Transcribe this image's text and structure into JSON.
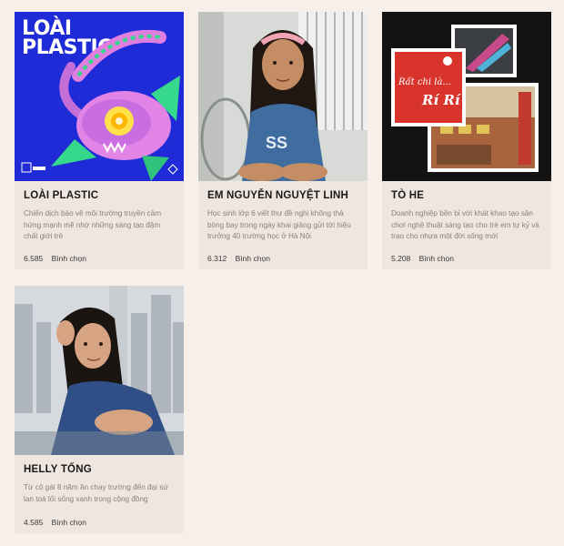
{
  "colors": {
    "page_bg": "#f7efea",
    "card_bg": "#efe6e0",
    "title": "#1a1a1a",
    "desc": "#8c7f78",
    "plastic_blue": "#1f2bd6",
    "tohe_red": "#d9342c"
  },
  "cards": [
    {
      "image_icon": "loai-plastic-artwork",
      "image_text_line1": "LOÀI",
      "image_text_line2": "PLASTIC",
      "title": "LOÀI PLASTIC",
      "description": "Chiến dịch bảo vệ môi trường truyền cảm hứng mạnh mẽ nhờ những sáng tạo đậm chất giới trẻ",
      "vote_count": "6.585",
      "vote_label": "Bình chọn"
    },
    {
      "image_icon": "girl-portrait-photo",
      "title": "EM NGUYỄN NGUYỆT LINH",
      "description": "Học sinh lớp 6 viết thư đề nghị không thả bóng bay trong ngày khai giảng gửi tới hiệu trưởng 40 trường học ở Hà Nội",
      "vote_count": "6.312",
      "vote_label": "Bình chọn"
    },
    {
      "image_icon": "to-he-collage",
      "image_text_line1": "Rất chi là...",
      "image_text_line2": "Rí Rí",
      "title": "TÒ HE",
      "description": "Doanh nghiệp bền bỉ với khát khao tạo sân chơi nghệ thuật sáng tạo cho trẻ em tự kỷ và trao cho nhựa một đời sống mới",
      "vote_count": "5.208",
      "vote_label": "Bình chọn"
    },
    {
      "image_icon": "woman-portrait-photo",
      "title": "HELLY TỐNG",
      "description": "Từ cô gái 8 năm ăn chay trường đến đại sứ lan toả lối sống xanh trong cộng đồng",
      "vote_count": "4.585",
      "vote_label": "Bình chọn"
    }
  ]
}
